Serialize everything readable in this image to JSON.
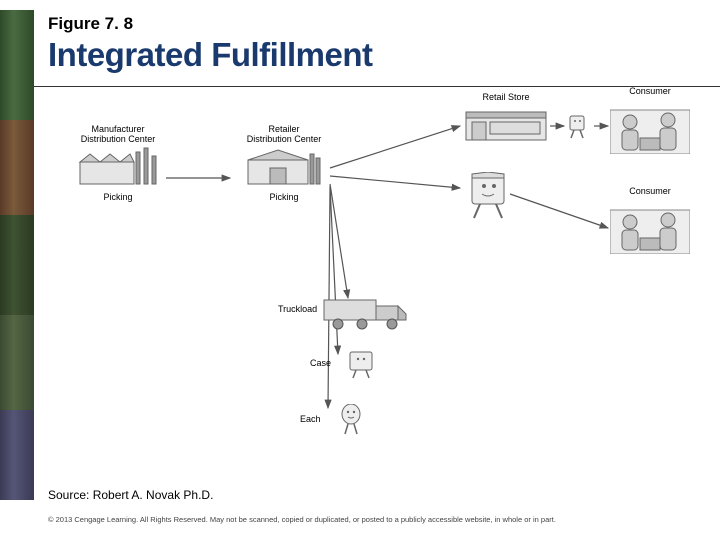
{
  "header": {
    "figure_number": "Figure 7. 8",
    "title": "Integrated Fulfillment"
  },
  "nodes": {
    "mfg_dc": {
      "top": "Manufacturer",
      "top2": "Distribution Center",
      "bottom": "Picking"
    },
    "ret_dc": {
      "top": "Retailer",
      "top2": "Distribution Center",
      "bottom": "Picking"
    },
    "retail_store": {
      "top": "Retail Store"
    },
    "consumer1": {
      "top": "Consumer"
    },
    "consumer2": {
      "top": "Consumer"
    },
    "truckload": {
      "label": "Truckload"
    },
    "case": {
      "label": "Case"
    },
    "each": {
      "label": "Each"
    }
  },
  "source": "Source:  Robert A. Novak Ph.D.",
  "copyright": "© 2013 Cengage Learning. All Rights Reserved. May not be scanned, copied or duplicated, or posted to a publicly accessible website, in whole or in part."
}
